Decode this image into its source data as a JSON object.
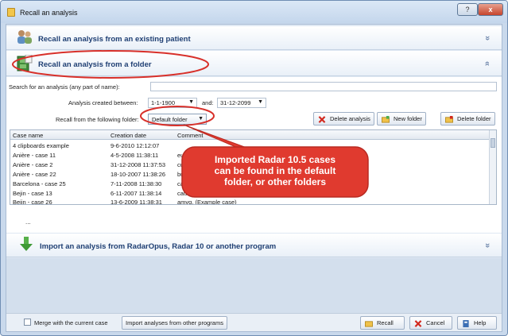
{
  "window": {
    "title": "Recall an analysis",
    "help_glyph": "?",
    "close_glyph": "x"
  },
  "sections": {
    "existing_patient": {
      "title": "Recall an analysis from an existing patient",
      "toggle": "»"
    },
    "folder": {
      "title": "Recall an analysis from a folder",
      "toggle": "»"
    },
    "import": {
      "title": "Import an analysis from RadarOpus, Radar 10 or another program",
      "toggle": "»"
    }
  },
  "form": {
    "search_label": "Search for an analysis (any part of name):",
    "search_value": "",
    "created_label": "Analysis created between:",
    "date_from": "1-1-1900",
    "and_label": "and:",
    "date_to": "31-12-2099",
    "folder_label": "Recall from the following folder:",
    "folder_value": "Default folder"
  },
  "toolbar": {
    "delete_analysis": "Delete analysis",
    "new_folder": "New folder",
    "delete_folder": "Delete folder"
  },
  "grid": {
    "columns": [
      "Case name",
      "Creation date",
      "Comment"
    ],
    "rows": [
      [
        "4 clipboards example",
        "9-6-2010 12:12:07",
        ""
      ],
      [
        "Anière - case 11",
        "4-5-2008 11:38:11",
        "eu"
      ],
      [
        "Anière - case 2",
        "31-12-2008 11:37:53",
        "cu"
      ],
      [
        "Anière - case 22",
        "18-10-2007 11:38:26",
        "bu"
      ],
      [
        "Barcelona - case 25",
        "7-11-2008 11:38:30",
        "ca"
      ],
      [
        "Bejin - case 13",
        "6-11-2007 11:38:14",
        "caus"
      ],
      [
        "Bejin - case 26",
        "13-6-2009 11:38:31",
        "amyg. (Example case)"
      ]
    ]
  },
  "more": "...",
  "callout": {
    "lines": [
      "Imported Radar 10.5 cases",
      "can be found in the default",
      "folder, or other folders"
    ],
    "fill": "#e03a2f"
  },
  "footer": {
    "merge_label": "Merge with the current case",
    "import_button": "Import analyses from other programs",
    "recall_button": "Recall",
    "cancel_button": "Cancel",
    "help_button": "Help"
  },
  "colors": {
    "header_text": "#1f3f73",
    "highlight_red": "#d8302a",
    "callout_red": "#e03a2f"
  }
}
